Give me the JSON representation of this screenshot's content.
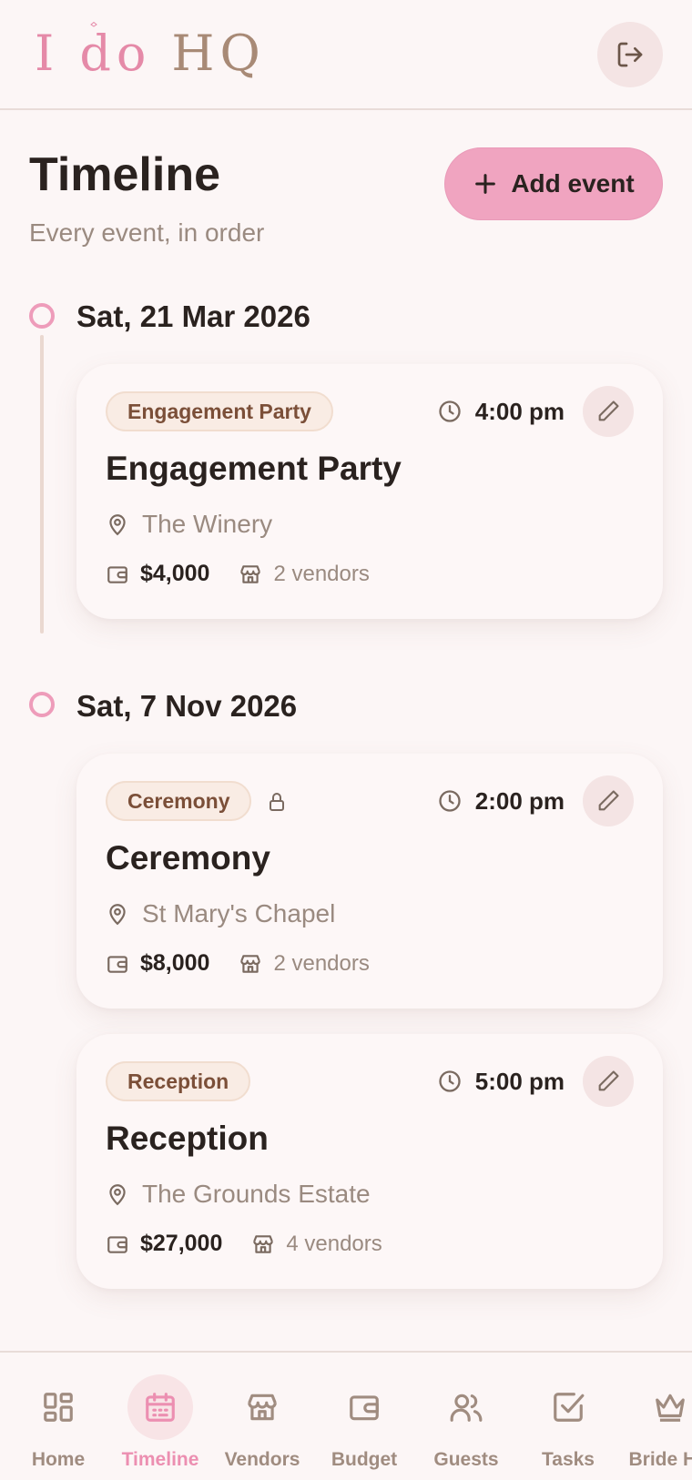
{
  "header": {
    "logo": {
      "part1": "I",
      "part2": "do",
      "part3": "HQ"
    }
  },
  "page": {
    "title": "Timeline",
    "subtitle": "Every event, in order",
    "add_label": "Add event"
  },
  "timeline": [
    {
      "date": "Sat, 21 Mar 2026",
      "events": [
        {
          "tag": "Engagement Party",
          "locked": false,
          "time": "4:00 pm",
          "title": "Engagement Party",
          "location": "The Winery",
          "budget": "$4,000",
          "vendors": "2 vendors"
        }
      ]
    },
    {
      "date": "Sat, 7 Nov 2026",
      "events": [
        {
          "tag": "Ceremony",
          "locked": true,
          "time": "2:00 pm",
          "title": "Ceremony",
          "location": "St Mary's Chapel",
          "budget": "$8,000",
          "vendors": "2 vendors"
        },
        {
          "tag": "Reception",
          "locked": false,
          "time": "5:00 pm",
          "title": "Reception",
          "location": "The Grounds Estate",
          "budget": "$27,000",
          "vendors": "4 vendors"
        }
      ]
    }
  ],
  "nav": [
    {
      "label": "Home",
      "icon": "grid-icon",
      "active": false
    },
    {
      "label": "Timeline",
      "icon": "calendar-icon",
      "active": true
    },
    {
      "label": "Vendors",
      "icon": "store-icon",
      "active": false
    },
    {
      "label": "Budget",
      "icon": "wallet-icon",
      "active": false
    },
    {
      "label": "Guests",
      "icon": "users-icon",
      "active": false
    },
    {
      "label": "Tasks",
      "icon": "check-square-icon",
      "active": false
    },
    {
      "label": "Bride HQ",
      "icon": "crown-icon",
      "active": false
    }
  ],
  "colors": {
    "accent_pink": "#f0a4c0",
    "background": "#fcf6f6",
    "text_dark": "#2a221f",
    "text_muted": "#9a8a80",
    "tag_text": "#7b4f38"
  }
}
